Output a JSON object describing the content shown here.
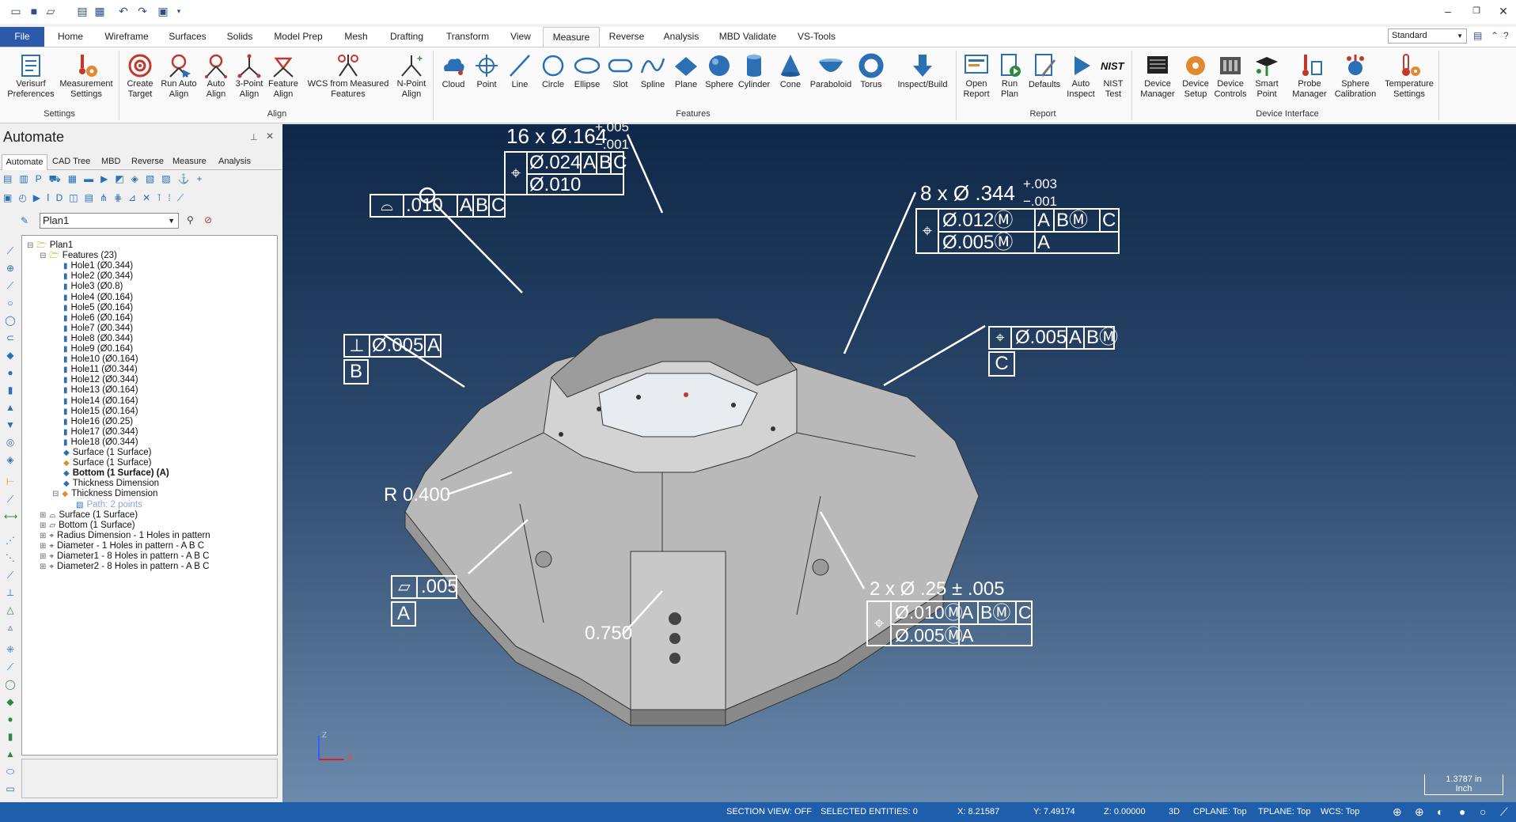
{
  "colors": {
    "accent": "#2a5aa8",
    "status_bar": "#1f5eaa",
    "viewport_top": "#0f2748",
    "viewport_bottom": "#6c8aab"
  },
  "qat_icons": [
    "new-file-icon",
    "save-icon",
    "open-folder-icon",
    "print-icon",
    "print-preview-icon",
    "undo-icon",
    "redo-icon",
    "view-options-icon",
    "customize-qat-icon"
  ],
  "ribbon_tabs": [
    "File",
    "Home",
    "Wireframe",
    "Surfaces",
    "Solids",
    "Model Prep",
    "Mesh",
    "Drafting",
    "Transform",
    "View",
    "Measure",
    "Reverse",
    "Analysis",
    "MBD Validate",
    "VS-Tools"
  ],
  "active_tab": "Measure",
  "style_select": "Standard",
  "ribbon": {
    "settings": [
      "Verisurf Preferences",
      "Measurement Settings"
    ],
    "align": [
      "Create Target",
      "Run Auto Align",
      "Auto Align",
      "3-Point Align",
      "Feature Align",
      "WCS from Measured Features",
      "N-Point Align"
    ],
    "features": [
      "Cloud",
      "Point",
      "Line",
      "Circle",
      "Ellipse",
      "Slot",
      "Spline",
      "Plane",
      "Sphere",
      "Cylinder",
      "Cone",
      "Paraboloid",
      "Torus",
      "Inspect/Build"
    ],
    "report": [
      "Open Report",
      "Run Plan",
      "Defaults",
      "Auto Inspect",
      "NIST Test"
    ],
    "device": [
      "Device Manager",
      "Device Setup",
      "Device Controls",
      "Smart Point",
      "Probe Manager",
      "Sphere Calibration",
      "Temperature Settings"
    ]
  },
  "groups": [
    "Settings",
    "Align",
    "Features",
    "Report",
    "Device Interface"
  ],
  "panel": {
    "title": "Automate",
    "tabs": [
      "Automate",
      "CAD Tree",
      "MBD",
      "Reverse",
      "Measure",
      "Analysis"
    ],
    "plan_select": "Plan1"
  },
  "tree": [
    {
      "text": "Plan1",
      "level": 0,
      "icon": "folder-open-icon"
    },
    {
      "text": "Features (23)",
      "level": 1,
      "icon": "folder-open-icon"
    },
    {
      "text": "Hole1 (Ø0.344)",
      "level": 2,
      "icon": "cylinder-icon"
    },
    {
      "text": "Hole2 (Ø0.344)",
      "level": 2,
      "icon": "cylinder-icon"
    },
    {
      "text": "Hole3 (Ø0.8)",
      "level": 2,
      "icon": "cylinder-icon"
    },
    {
      "text": "Hole4 (Ø0.164)",
      "level": 2,
      "icon": "cylinder-icon"
    },
    {
      "text": "Hole5 (Ø0.164)",
      "level": 2,
      "icon": "cylinder-icon"
    },
    {
      "text": "Hole6 (Ø0.164)",
      "level": 2,
      "icon": "cylinder-icon"
    },
    {
      "text": "Hole7 (Ø0.344)",
      "level": 2,
      "icon": "cylinder-icon"
    },
    {
      "text": "Hole8 (Ø0.344)",
      "level": 2,
      "icon": "cylinder-icon"
    },
    {
      "text": "Hole9 (Ø0.164)",
      "level": 2,
      "icon": "cylinder-icon"
    },
    {
      "text": "Hole10 (Ø0.164)",
      "level": 2,
      "icon": "cylinder-icon"
    },
    {
      "text": "Hole11 (Ø0.344)",
      "level": 2,
      "icon": "cylinder-icon"
    },
    {
      "text": "Hole12 (Ø0.344)",
      "level": 2,
      "icon": "cylinder-icon"
    },
    {
      "text": "Hole13 (Ø0.164)",
      "level": 2,
      "icon": "cylinder-icon"
    },
    {
      "text": "Hole14 (Ø0.164)",
      "level": 2,
      "icon": "cylinder-icon"
    },
    {
      "text": "Hole15 (Ø0.164)",
      "level": 2,
      "icon": "cylinder-icon"
    },
    {
      "text": "Hole16 (Ø0.25)",
      "level": 2,
      "icon": "cylinder-icon"
    },
    {
      "text": "Hole17 (Ø0.344)",
      "level": 2,
      "icon": "cylinder-icon"
    },
    {
      "text": "Hole18 (Ø0.344)",
      "level": 2,
      "icon": "cylinder-icon"
    },
    {
      "text": "Surface (1 Surface)",
      "level": 2,
      "icon": "surface-icon"
    },
    {
      "text": "Surface (1 Surface)",
      "level": 2,
      "icon": "surface-multi-icon"
    },
    {
      "text": "Bottom (1 Surface) (A)",
      "level": 2,
      "icon": "surface-icon",
      "bold": true
    },
    {
      "text": "Thickness Dimension",
      "level": 2,
      "icon": "surface-icon"
    },
    {
      "text": "Thickness Dimension",
      "level": 2,
      "icon": "surface-multi-icon",
      "expanded": true
    },
    {
      "text": "Path: 2 points",
      "level": 3,
      "icon": "path-icon",
      "muted": true
    },
    {
      "text": "Surface (1 Surface)",
      "level": 1,
      "icon": "profile-icon",
      "collapsed": true
    },
    {
      "text": "Bottom (1 Surface)",
      "level": 1,
      "icon": "flatness-icon",
      "collapsed": true
    },
    {
      "text": "Radius Dimension - 1 Holes in pattern",
      "level": 1,
      "icon": "position-icon",
      "collapsed": true
    },
    {
      "text": "Diameter - 1 Holes in pattern - A B C",
      "level": 1,
      "icon": "position-icon",
      "collapsed": true
    },
    {
      "text": "Diameter1 - 8 Holes in pattern - A B C",
      "level": 1,
      "icon": "position-icon",
      "collapsed": true
    },
    {
      "text": "Diameter2 - 8 Holes in pattern - A B C",
      "level": 1,
      "icon": "position-icon",
      "collapsed": true
    }
  ],
  "annotations": {
    "a1_qty": "16 x Ø.164",
    "a1_tol_upper": "+.005",
    "a1_tol_lower": "−.001",
    "a1_row1": [
      "Ø.024",
      "A",
      "B",
      "C"
    ],
    "a1_row2": "Ø.010",
    "profile": [
      ".010",
      "A",
      "B",
      "C"
    ],
    "a2_qty": "8 x Ø .344",
    "a2_tol_upper": "+.003",
    "a2_tol_lower": "−.001",
    "a2_row1": [
      "Ø.012Ⓜ",
      "A",
      "BⓂ",
      "C"
    ],
    "a2_row2": [
      "Ø.005Ⓜ",
      "A"
    ],
    "perp": [
      "Ø.005",
      "A"
    ],
    "datum_b": "B",
    "pos_c": [
      "Ø.005",
      "A",
      "BⓂ"
    ],
    "datum_c": "C",
    "radius": "R 0.400",
    "flat": ".005",
    "datum_a": "A",
    "thick": "0.750",
    "a3_qty": "2 x Ø .25 ± .005",
    "a3_row1": [
      "Ø.010Ⓜ",
      "A",
      "BⓂ",
      "C"
    ],
    "a3_row2": [
      "Ø.005Ⓜ",
      "A"
    ]
  },
  "axis": {
    "z": "Z",
    "x": "X"
  },
  "scale": {
    "value": "1.3787 in",
    "unit": "Inch"
  },
  "status": {
    "section": "SECTION VIEW: OFF",
    "selected": "SELECTED ENTITIES: 0",
    "x": "X:  8.21587",
    "y": "Y:  7.49174",
    "z": "Z:  0.00000",
    "mode": "3D",
    "cplane": "CPLANE: Top",
    "tplane": "TPLANE: Top",
    "wcs": "WCS: Top"
  }
}
